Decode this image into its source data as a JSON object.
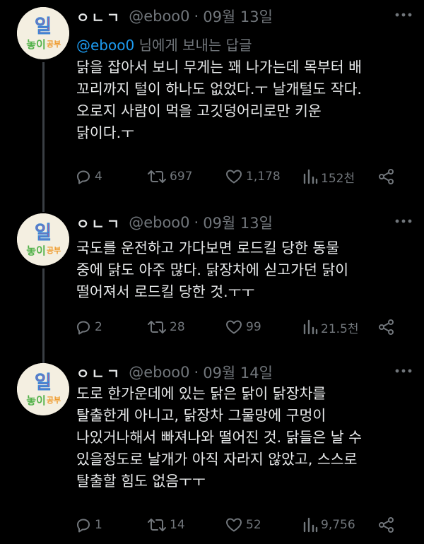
{
  "tweets": [
    {
      "name": "ㅇㄴㄱ",
      "handle": "@eboo0",
      "dot": "·",
      "date": "09월 13일",
      "replying_mention": "@eboo0",
      "replying_rest": "님에게 보내는 답글",
      "lines": [
        "닭을 잡아서 보니 무게는 꽤 나가는데 목부터 배",
        "꼬리까지 털이 하나도 없었다.ㅜ 날개털도 작다.",
        "오로지 사람이 먹을 고깃덩어리로만 키운",
        "닭이다.ㅜ"
      ],
      "replies": "4",
      "retweets": "697",
      "likes": "1,178",
      "views": "152천"
    },
    {
      "name": "ㅇㄴㄱ",
      "handle": "@eboo0",
      "dot": "·",
      "date": "09월 13일",
      "lines": [
        "국도를 운전하고 가다보면 로드킬 당한 동물",
        "중에 닭도 아주 많다. 닭장차에 싣고가던 닭이",
        "떨어져서 로드킬 당한 것.ㅜㅜ"
      ],
      "replies": "2",
      "retweets": "28",
      "likes": "99",
      "views": "21.5천"
    },
    {
      "name": "ㅇㄴㄱ",
      "handle": "@eboo0",
      "dot": "·",
      "date": "09월 14일",
      "lines": [
        "도로 한가운데에 있는 닭은 닭이 닭장차를",
        "탈출한게 아니고, 닭장차 그물망에 구멍이",
        "나있거나해서 빠져나와 떨어진 것. 닭들은 날 수",
        "있을정도로 날개가 아직 자라지 않았고, 스스로",
        "탈출할 힘도 없음ㅜㅜ"
      ],
      "replies": "1",
      "retweets": "14",
      "likes": "52",
      "views": "9,756"
    }
  ],
  "avatar": {
    "line1": "일",
    "line2_a": "놓이",
    "line2_b": "공부",
    "colors": {
      "bg": "#f4efe1",
      "pink": "#e04f86",
      "green": "#53b24a",
      "orange": "#ef9b2c",
      "blue": "#3c86d6"
    }
  },
  "icons": {
    "more": "more-horizontal-icon",
    "reply": "reply-icon",
    "retweet": "retweet-icon",
    "like": "heart-icon",
    "views": "views-bar-icon",
    "share": "share-icon"
  },
  "theme": {
    "bg": "#000000",
    "text": "#e7e9ea",
    "muted": "#71767b",
    "link": "#1d9bf0"
  }
}
